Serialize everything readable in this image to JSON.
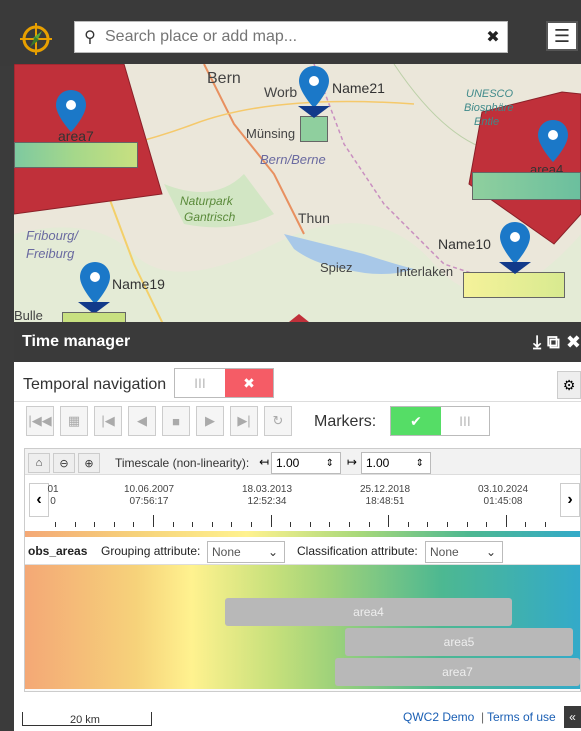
{
  "search": {
    "placeholder": "Search place or add map..."
  },
  "map": {
    "labels": {
      "bern": "Bern",
      "worb": "Worb",
      "munsingen": "Münsing",
      "bern_region": "Bern/Berne",
      "naturpark": "Naturpark",
      "gantrisch": "Gantrisch",
      "thun": "Thun",
      "fribourg1": "Fribourg/",
      "fribourg2": "Freiburg",
      "spiez": "Spiez",
      "interlaken": "Interlaken",
      "bulle": "Bulle",
      "unesco1": "UNESCO",
      "unesco2": "Biosphäre",
      "unesco3": "Entle"
    },
    "markers": {
      "area7": "area7",
      "name21": "Name21",
      "area4": "area4",
      "name10": "Name10",
      "name19": "Name19"
    }
  },
  "panel": {
    "title": "Time manager",
    "temporal_navigation": "Temporal navigation",
    "markers_label": "Markers:",
    "toggle_off": "III",
    "toggle_x": "✖",
    "toggle_check": "✔"
  },
  "timeline": {
    "timescale_label": "Timescale (non-linearity):",
    "factor1": "1.00",
    "factor2": "1.00",
    "ticks": [
      {
        "date": "01",
        "time": "0"
      },
      {
        "date": "10.06.2007",
        "time": "07:56:17"
      },
      {
        "date": "18.03.2013",
        "time": "12:52:34"
      },
      {
        "date": "25.12.2018",
        "time": "18:48:51"
      },
      {
        "date": "03.10.2024",
        "time": "01:45:08"
      }
    ],
    "layer": "obs_areas",
    "grouping_label": "Grouping attribute:",
    "grouping_value": "None",
    "classification_label": "Classification attribute:",
    "classification_value": "None",
    "events": [
      "area4",
      "area5",
      "area7"
    ]
  },
  "footer": {
    "scale": "20 km",
    "demo": "QWC2 Demo",
    "sep": "|",
    "terms": "Terms of use",
    "collapse": "«"
  }
}
